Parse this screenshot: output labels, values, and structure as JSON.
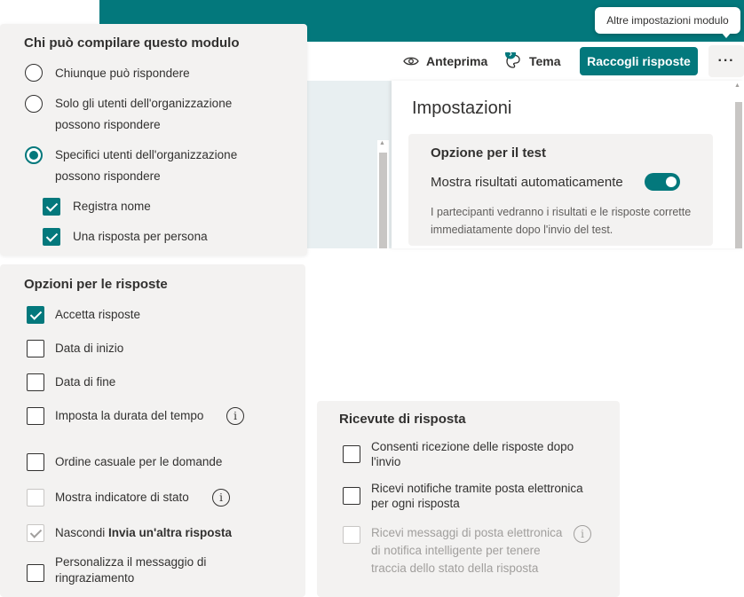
{
  "colors": {
    "accent": "#03787c",
    "panel": "#f3f2f1",
    "text": "#323130"
  },
  "toolbar": {
    "preview_label": "Anteprima",
    "theme_label": "Tema",
    "collect_label": "Raccogli risposte",
    "more_label": "···",
    "tooltip": "Altre impostazioni modulo"
  },
  "settings": {
    "title": "Impostazioni",
    "test_option_title": "Opzione per il test",
    "show_results_label": "Mostra risultati automaticamente",
    "show_results_on": true,
    "show_results_desc": "I partecipanti vedranno i risultati e le risposte corrette immediatamente dopo l'invio del test."
  },
  "who": {
    "title": "Chi può compilare questo modulo",
    "options": [
      {
        "label": "Chiunque può rispondere",
        "checked": false
      },
      {
        "label_line1": "Solo gli utenti dell'organizzazione",
        "label_line2": "possono rispondere",
        "checked": false
      },
      {
        "label_line1": "Specifici utenti dell'organizzazione",
        "label_line2": "possono rispondere",
        "checked": true
      }
    ],
    "sub_options": [
      {
        "label": "Registra nome",
        "checked": true
      },
      {
        "label": "Una risposta per persona",
        "checked": true
      }
    ]
  },
  "responses": {
    "title": "Opzioni per le risposte",
    "accept": "Accetta risposte",
    "start_date": "Data di inizio",
    "end_date": "Data di fine",
    "time_limit": "Imposta la durata del tempo",
    "shuffle": "Ordine casuale per le domande",
    "progress_bar": "Mostra indicatore di stato",
    "hide_prefix": "Nascondi ",
    "hide_bold": "Invia un'altra risposta",
    "thanks_line1": "Personalizza il messaggio di",
    "thanks_line2": "ringraziamento"
  },
  "receipts": {
    "title": "Ricevute di risposta",
    "allow_line1": "Consenti ricezione delle risposte dopo",
    "allow_line2": "l'invio",
    "email_line1": "Ricevi notifiche tramite posta elettronica",
    "email_line2": "per ogni risposta",
    "smart_line1": "Ricevi messaggi di posta elettronica",
    "smart_line2": "di notifica intelligente per tenere",
    "smart_line3": "traccia dello stato della risposta"
  }
}
